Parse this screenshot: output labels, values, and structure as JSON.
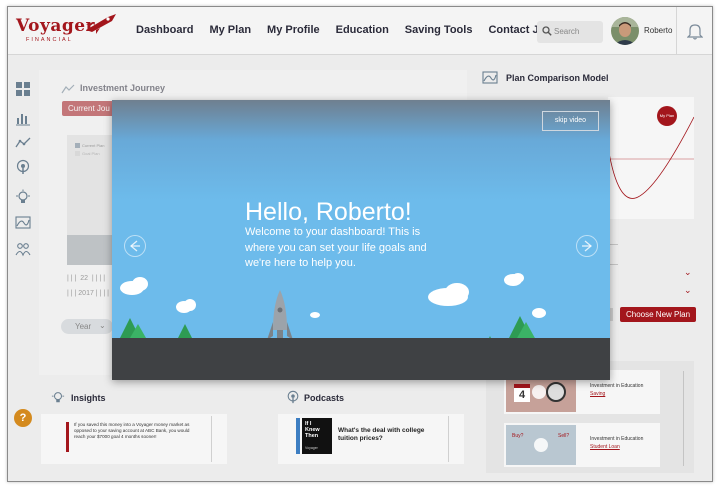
{
  "brand": {
    "name": "Voyager",
    "tagline": "FINANCIAL",
    "accent_color": "#a3161c"
  },
  "nav": {
    "items": [
      "Dashboard",
      "My Plan",
      "My Profile",
      "Education",
      "Saving Tools",
      "Contact John"
    ]
  },
  "search": {
    "placeholder": "Search"
  },
  "user": {
    "name": "Roberto"
  },
  "sidebar": {
    "icons": [
      "dashboard-icon",
      "bar-chart-icon",
      "trend-icon",
      "podcast-icon",
      "lightbulb-icon",
      "plan-model-icon",
      "people-icon"
    ],
    "help_label": "?"
  },
  "investment_journey": {
    "title": "Investment Journey",
    "current_button": "Current Jou",
    "legend": [
      "Current Plan",
      "Goal Plan"
    ],
    "row1": "| | |  22  | | | |",
    "row2": "| | | 2017 | | | |",
    "year_label": "Year"
  },
  "plan_comparison": {
    "title": "Plan Comparison Model",
    "badge_my_plan": "My Plan",
    "badge_plan": "Plan",
    "choose_button": "Choose New Plan"
  },
  "insights": {
    "title": "Insights",
    "text": "If you saved this money into a Voyager money market as opposed to your saving account at ABC Bank, you would reach your $7000 goal 4 months sooner!"
  },
  "podcasts": {
    "title": "Podcasts",
    "cover_text": "If I Knew Then",
    "cover_brand": "Voyager",
    "episode_title": "What's the deal with college tuition prices?"
  },
  "education": {
    "items": [
      {
        "heading": "Investment in Education",
        "link": "Saving",
        "thumb_text": "4"
      },
      {
        "heading": "Investment in Education",
        "link": "Student Loan",
        "thumb_text_left": "Buy?",
        "thumb_text_right": "Sell?"
      }
    ]
  },
  "modal": {
    "skip_label": "skip video",
    "hello": "Hello, Roberto!",
    "welcome": "Welcome to your dashboard! This is where you can set your life goals and we're here to help you."
  }
}
